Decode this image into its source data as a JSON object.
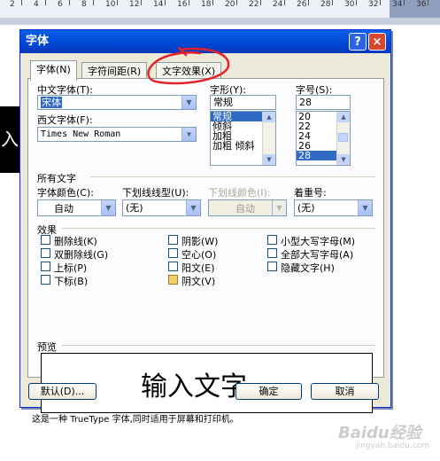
{
  "ruler": {
    "numbers": [
      "2",
      "4",
      "6",
      "8",
      "10",
      "12",
      "14",
      "16",
      "18",
      "20",
      "22",
      "24",
      "26",
      "28",
      "30",
      "32",
      "34",
      "36"
    ]
  },
  "bg_text": "入",
  "dialog": {
    "title": "字体",
    "help_label": "?",
    "close_label": "×",
    "tabs": [
      "字体(N)",
      "字符间距(R)",
      "文字效果(X)"
    ],
    "labels": {
      "cn_font": "中文字体(T):",
      "west_font": "西文字体(F):",
      "style": "字形(Y):",
      "size": "字号(S):",
      "all_text": "所有文字",
      "font_color": "字体颜色(C):",
      "underline_type": "下划线线型(U):",
      "underline_color": "下划线颜色(I):",
      "emphasis": "着重号:",
      "effects": "效果",
      "preview": "预览"
    },
    "cn_font_value": "宋体",
    "west_font_value": "Times New Roman",
    "style_input": "常规",
    "style_list": [
      "常规",
      "倾斜",
      "加粗",
      "加粗 倾斜"
    ],
    "style_selected": "常规",
    "size_input": "28",
    "size_list": [
      "20",
      "22",
      "24",
      "26",
      "28"
    ],
    "size_selected": "28",
    "font_color_value": "自动",
    "underline_type_value": "(无)",
    "underline_color_value": "自动",
    "emphasis_value": "(无)",
    "effects": {
      "col1": [
        {
          "label": "删除线(K)",
          "checked": false
        },
        {
          "label": "双删除线(G)",
          "checked": false
        },
        {
          "label": "上标(P)",
          "checked": false
        },
        {
          "label": "下标(B)",
          "checked": false
        }
      ],
      "col2": [
        {
          "label": "阴影(W)",
          "checked": false
        },
        {
          "label": "空心(O)",
          "checked": false
        },
        {
          "label": "阳文(E)",
          "checked": false
        },
        {
          "label": "阴文(V)",
          "checked": true
        }
      ],
      "col3": [
        {
          "label": "小型大写字母(M)",
          "checked": false
        },
        {
          "label": "全部大写字母(A)",
          "checked": false
        },
        {
          "label": "隐藏文字(H)",
          "checked": false
        }
      ]
    },
    "preview_text": "输入文字",
    "footer_note": "这是一种 TrueType 字体,同时适用于屏幕和打印机。",
    "buttons": {
      "default": "默认(D)...",
      "ok": "确定",
      "cancel": "取消"
    }
  },
  "watermark": {
    "brand": "Baidu经验",
    "url": "jingyan.baidu.com"
  },
  "colors": {
    "title_blue": "#0a5fe8",
    "selection": "#316ac5",
    "dialog_bg": "#ece9d8",
    "annotation_red": "#e4222a"
  }
}
